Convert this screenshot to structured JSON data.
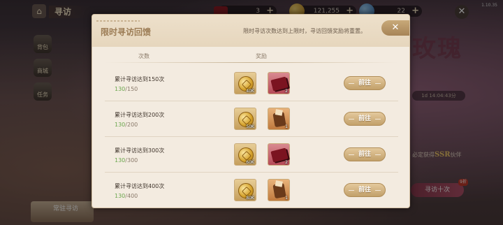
{
  "version": "1.10.35",
  "topbar": {
    "title": "寻访",
    "resources": [
      {
        "icon": "red-book-icon",
        "value": "3"
      },
      {
        "icon": "gold-coin-icon",
        "value": "121,255"
      },
      {
        "icon": "blue-gem-icon",
        "value": "22"
      }
    ],
    "plus": "+",
    "close": "✕"
  },
  "sidebar": {
    "items": [
      {
        "label": "背包"
      },
      {
        "label": "商城"
      },
      {
        "label": "任务"
      }
    ]
  },
  "background": {
    "rose_text": "玫瑰",
    "pill_text": "1d 14:04:43分",
    "ssr_prefix": "必定获得",
    "ssr_mark": "SSR",
    "ssr_suffix": "伙伴",
    "visit_btn": "寻访十次",
    "visit_tag": "9折",
    "bottom_banner": "常驻寻访"
  },
  "dialog": {
    "title": "限时寻访回馈",
    "hint": "限时寻访次数达到上限时，寻访回馈奖励将重置。",
    "close_icon": "✕",
    "col_count": "次数",
    "col_reward": "奖励",
    "go_label": "前往",
    "rows": [
      {
        "label": "累计寻访达到150次",
        "current": "130",
        "target": "/150",
        "reward1": {
          "icon": "gold-coin-icon",
          "qty": "40K"
        },
        "reward2": {
          "icon": "red-book-icon",
          "qty": "2",
          "kind": "book"
        }
      },
      {
        "label": "累计寻访达到200次",
        "current": "130",
        "target": "/200",
        "reward1": {
          "icon": "gold-coin-icon",
          "qty": "50K"
        },
        "reward2": {
          "icon": "scroll-pouch-icon",
          "qty": "1",
          "kind": "pouch"
        }
      },
      {
        "label": "累计寻访达到300次",
        "current": "130",
        "target": "/300",
        "reward1": {
          "icon": "gold-coin-icon",
          "qty": "60K"
        },
        "reward2": {
          "icon": "red-book-icon",
          "qty": "2",
          "kind": "book"
        }
      },
      {
        "label": "累计寻访达到400次",
        "current": "130",
        "target": "/400",
        "reward1": {
          "icon": "gold-coin-icon",
          "qty": "80K"
        },
        "reward2": {
          "icon": "scroll-pouch-icon",
          "qty": "1",
          "kind": "pouch"
        }
      }
    ]
  }
}
